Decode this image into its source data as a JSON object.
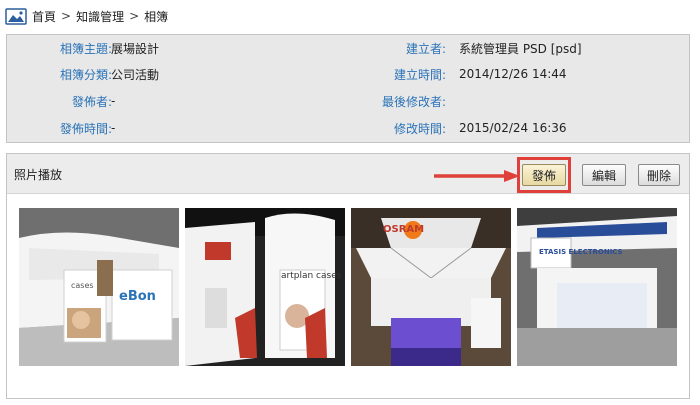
{
  "breadcrumb": {
    "items": [
      "首頁",
      "知識管理",
      "相簿"
    ],
    "separator": ">"
  },
  "info": {
    "left": [
      {
        "label": "相簿主題:",
        "value": "展場設計"
      },
      {
        "label": "相簿分類:",
        "value": "公司活動"
      },
      {
        "label": "發佈者:",
        "value": "-"
      },
      {
        "label": "發佈時間:",
        "value": "-"
      }
    ],
    "right": [
      {
        "label": "建立者:",
        "value": "系統管理員 PSD [psd]"
      },
      {
        "label": "建立時間:",
        "value": "2014/12/26 14:44"
      },
      {
        "label": "最後修改者:",
        "value": ""
      },
      {
        "label": "修改時間:",
        "value": "2015/02/24 16:36"
      }
    ]
  },
  "album": {
    "title": "照片播放",
    "buttons": {
      "publish": "發佈",
      "edit": "編輯",
      "delete": "刪除"
    }
  },
  "photos": [
    {
      "caption": "cases",
      "brand": "eBon"
    },
    {
      "caption": "artplan cases",
      "brand": ""
    },
    {
      "caption": "",
      "brand": "OSRAM"
    },
    {
      "caption": "",
      "brand": "ETASIS ELECTRONICS"
    }
  ],
  "colors": {
    "label": "#2a73b8",
    "highlight": "#e0403a",
    "info_bg": "#e8e8e8"
  }
}
